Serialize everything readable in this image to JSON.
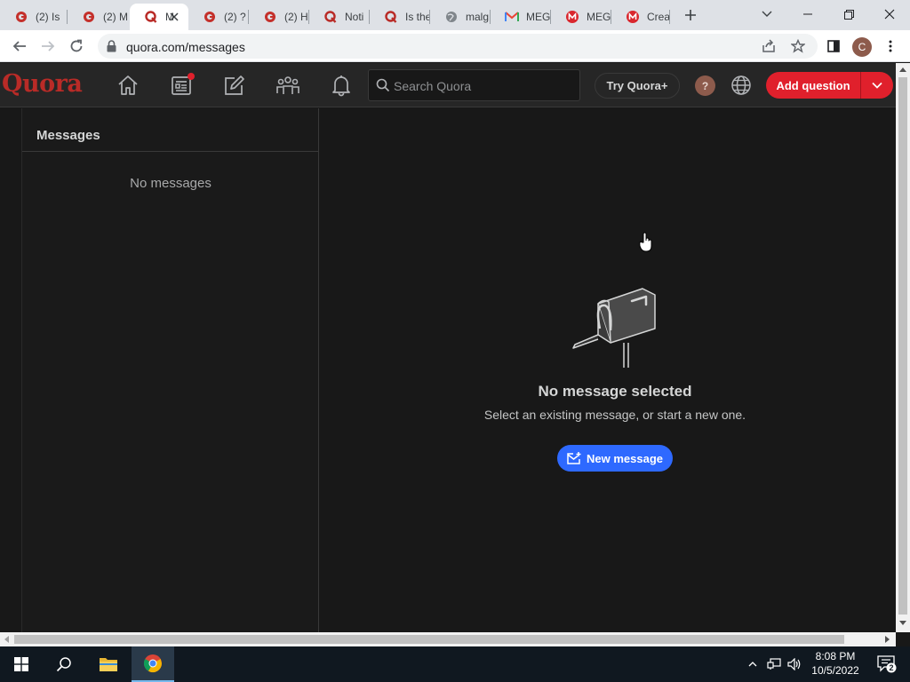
{
  "browser": {
    "tabs": [
      {
        "title": "(2) Is",
        "icon": "quora-g-icon"
      },
      {
        "title": "(2) M",
        "icon": "quora-g-icon"
      },
      {
        "title": "M",
        "icon": "quora-q-icon",
        "active": true
      },
      {
        "title": "(2) ?",
        "icon": "quora-g-icon"
      },
      {
        "title": "(2) H",
        "icon": "quora-g-icon"
      },
      {
        "title": "Noti",
        "icon": "quora-q-icon"
      },
      {
        "title": "Is the",
        "icon": "quora-q-icon"
      },
      {
        "title": "malg",
        "icon": "globe-icon"
      },
      {
        "title": "MEG",
        "icon": "gmail-icon"
      },
      {
        "title": "MEG",
        "icon": "mega-icon"
      },
      {
        "title": "Crea",
        "icon": "mega-icon"
      }
    ],
    "url": "quora.com/messages",
    "profile_initial": "C"
  },
  "quora": {
    "logo": "Quora",
    "search_placeholder": "Search Quora",
    "try_plus": "Try Quora+",
    "help_label": "?",
    "add_question": "Add question"
  },
  "messages": {
    "panel_title": "Messages",
    "empty_list": "No messages",
    "none_selected_title": "No message selected",
    "none_selected_subtitle": "Select an existing message, or start a new one.",
    "new_message": "New message"
  },
  "taskbar": {
    "time": "8:08 PM",
    "date": "10/5/2022",
    "notification_count": "2"
  },
  "colors": {
    "quora_red": "#b92b27",
    "add_question_red": "#e0202c",
    "new_message_blue": "#2e69ff",
    "dark_bg": "#181818",
    "header_bg": "#262626"
  }
}
